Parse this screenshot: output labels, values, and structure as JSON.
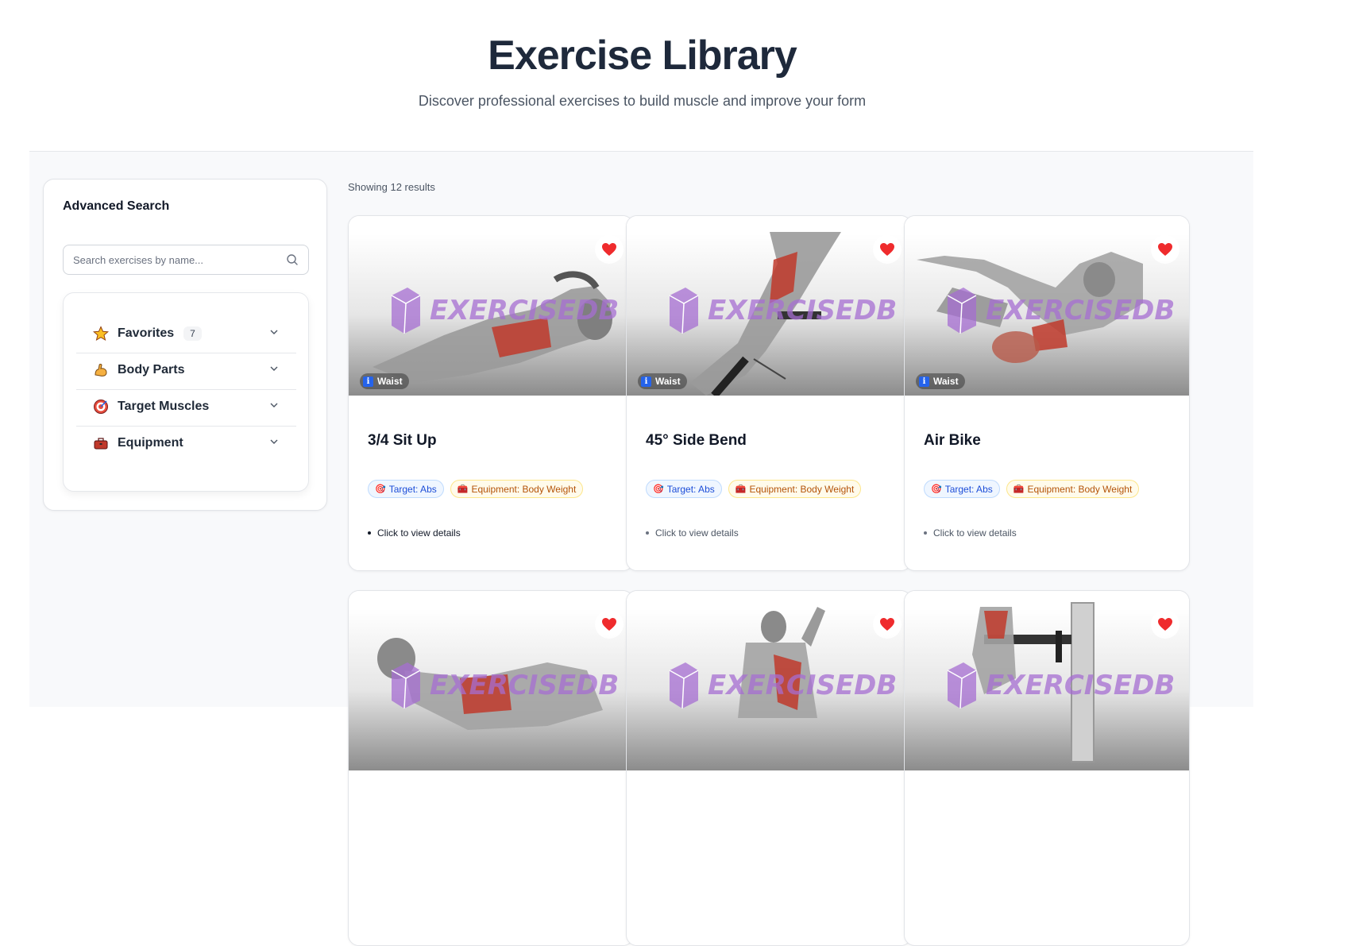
{
  "header": {
    "title": "Exercise Library",
    "subtitle": "Discover professional exercises to build muscle and improve your form"
  },
  "sidebar": {
    "title": "Advanced Search",
    "search": {
      "placeholder": "Search exercises by name...",
      "value": ""
    },
    "filters": [
      {
        "label": "Favorites",
        "icon": "star-icon",
        "count": "7"
      },
      {
        "label": "Body Parts",
        "icon": "flexed-bicep-icon"
      },
      {
        "label": "Target Muscles",
        "icon": "target-icon"
      },
      {
        "label": "Equipment",
        "icon": "toolbox-icon"
      }
    ]
  },
  "results": {
    "count_text": "Showing 12 results"
  },
  "cards": [
    {
      "name": "3/4 Sit Up",
      "bodypart": "Waist",
      "target": "Target: Abs",
      "equipment": "Equipment: Body Weight",
      "details": "Click to view details",
      "watermark": "EXERCISEDB"
    },
    {
      "name": "45° Side Bend",
      "bodypart": "Waist",
      "target": "Target: Abs",
      "equipment": "Equipment: Body Weight",
      "details": "Click to view details",
      "watermark": "EXERCISEDB"
    },
    {
      "name": "Air Bike",
      "bodypart": "Waist",
      "target": "Target: Abs",
      "equipment": "Equipment: Body Weight",
      "details": "Click to view details",
      "watermark": "EXERCISEDB"
    },
    {
      "name": "",
      "bodypart": "",
      "target": "",
      "equipment": "",
      "details": "",
      "watermark": "EXERCISEDB"
    },
    {
      "name": "",
      "bodypart": "",
      "target": "",
      "equipment": "",
      "details": "",
      "watermark": "EXERCISEDB"
    },
    {
      "name": "",
      "bodypart": "",
      "target": "",
      "equipment": "",
      "details": "",
      "watermark": "EXERCISEDB"
    }
  ],
  "colors": {
    "heart": "#ef2b2d",
    "watermark": "#a56ed2",
    "muscle_highlight": "#c0392b",
    "target_tag": "#1d4ed8",
    "equipment_tag": "#b45309"
  }
}
